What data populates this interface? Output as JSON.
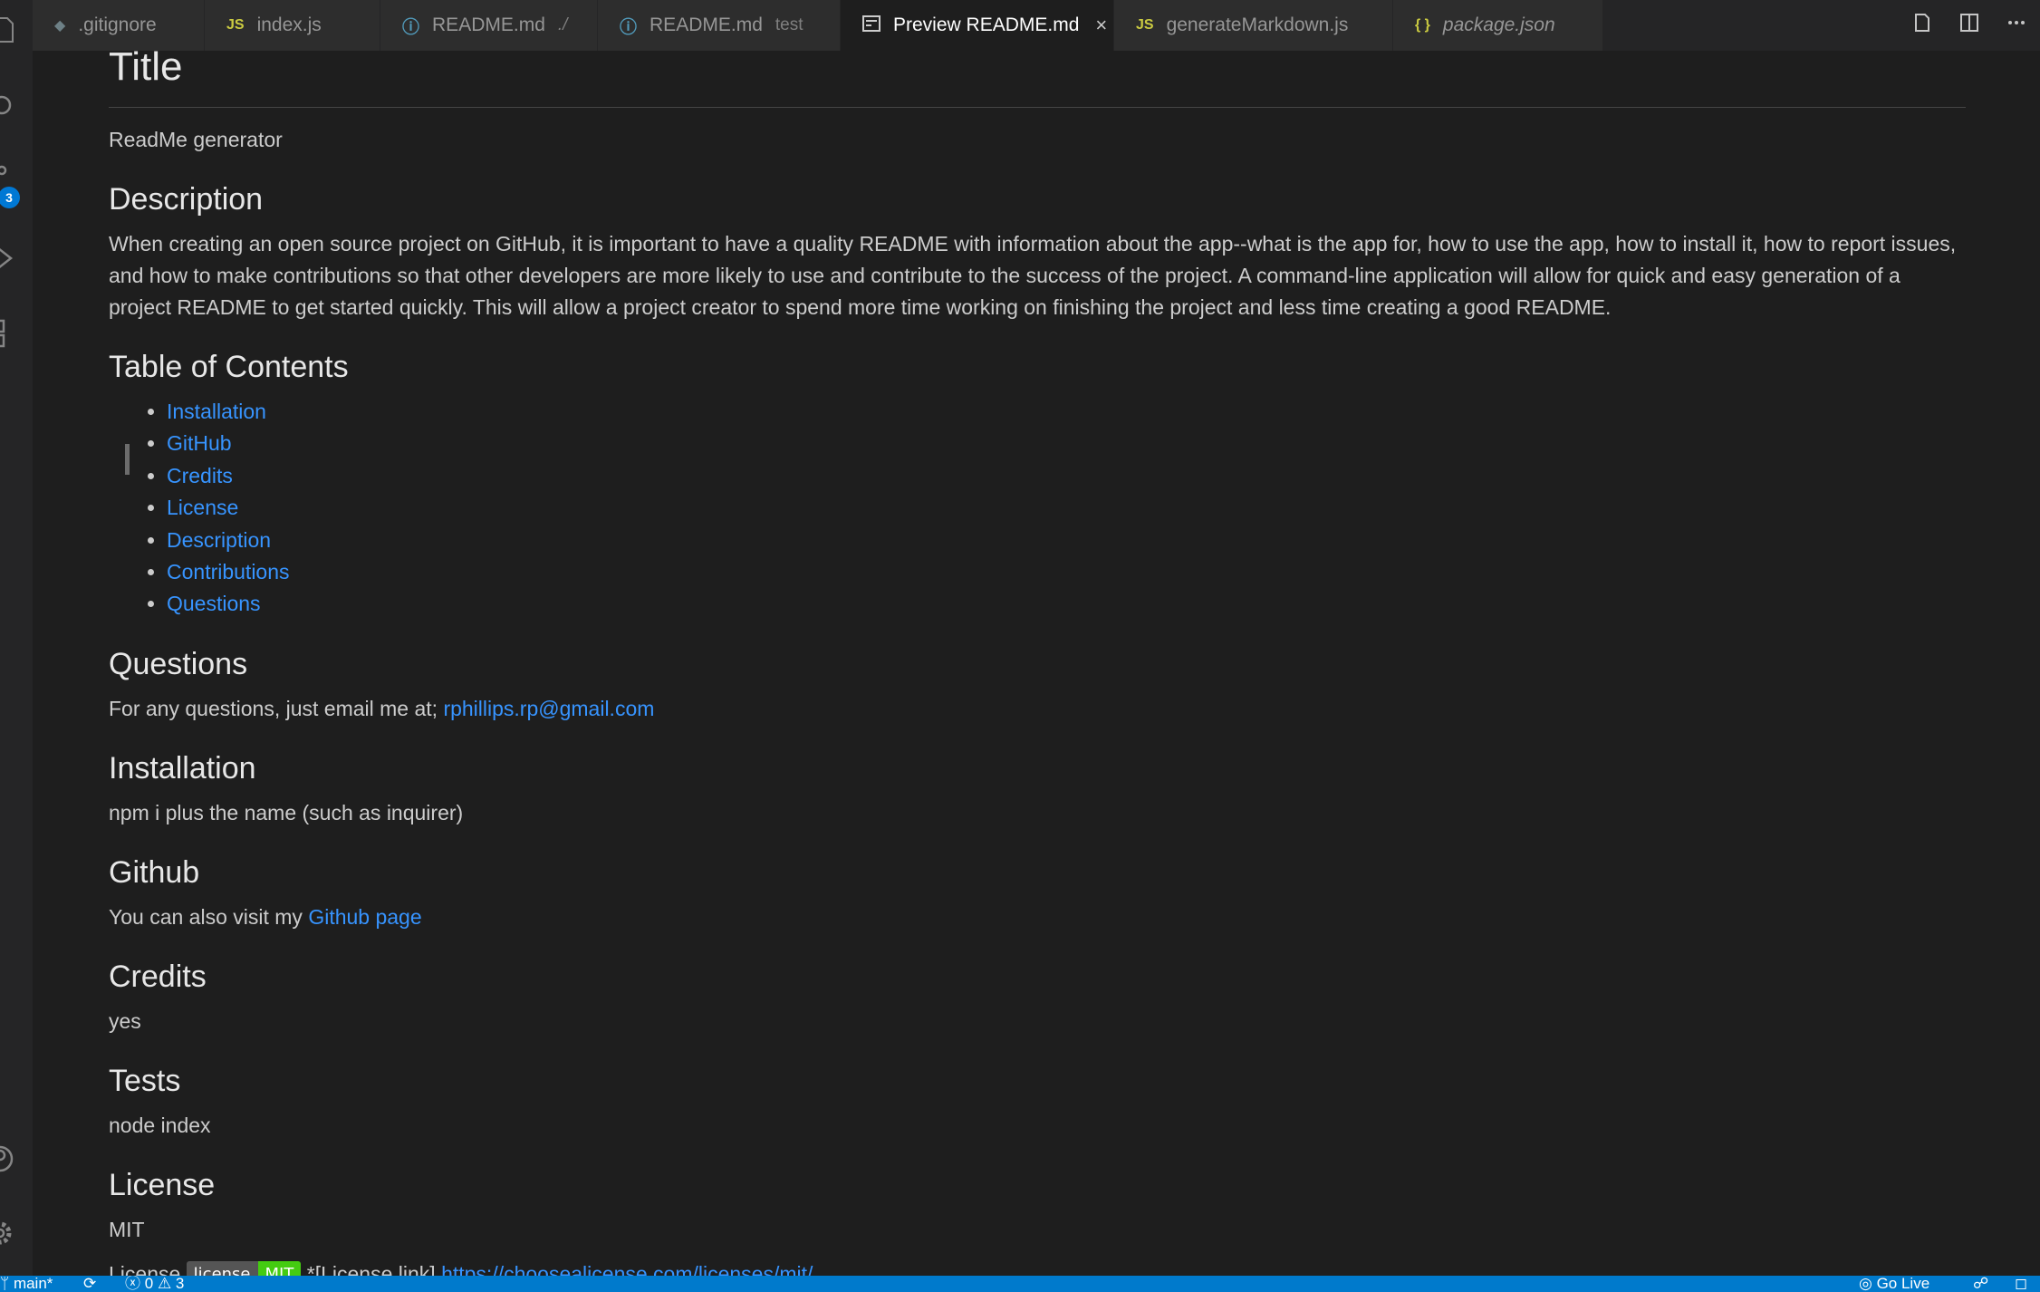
{
  "activity_bar": {
    "icons": [
      "explorer-icon",
      "search-icon",
      "source-control-icon",
      "run-debug-icon",
      "extensions-icon",
      "accounts-icon",
      "settings-gear-icon"
    ],
    "source_control_badge": "3"
  },
  "tabs": [
    {
      "label": ".gitignore",
      "icon": "git-icon",
      "desc": ""
    },
    {
      "label": "index.js",
      "icon": "js-icon",
      "desc": ""
    },
    {
      "label": "README.md",
      "icon": "info-icon",
      "desc": "./"
    },
    {
      "label": "README.md",
      "icon": "info-icon",
      "desc": "test"
    },
    {
      "label": "Preview README.md",
      "icon": "preview-icon",
      "desc": "",
      "active": true
    },
    {
      "label": "generateMarkdown.js",
      "icon": "js-icon",
      "desc": ""
    },
    {
      "label": "package.json",
      "icon": "json-icon",
      "desc": ""
    }
  ],
  "tab_glyphs": {
    "js": "JS",
    "json": "{ }",
    "git": "◆",
    "info": "ⓘ",
    "close": "×"
  },
  "editor_actions": [
    "open-source-icon",
    "split-editor-icon",
    "more-actions-icon"
  ],
  "readme": {
    "title": "Title",
    "title_text": "ReadMe generator",
    "description_heading": "Description",
    "description_text": "When creating an open source project on GitHub, it is important to have a quality README with information about the app--what is the app for, how to use the app, how to install it, how to report issues, and how to make contributions so that other developers are more likely to use and contribute to the success of the project. A command-line application will allow for quick and easy generation of a project README to get started quickly. This will allow a project creator to spend more time working on finishing the project and less time creating a good README.",
    "toc_heading": "Table of Contents",
    "toc": [
      "Installation",
      "GitHub",
      "Credits",
      "License",
      "Description",
      "Contributions",
      "Questions"
    ],
    "questions_heading": "Questions",
    "questions_text": "For any questions, just email me at; ",
    "questions_email": "rphillips.rp@gmail.com",
    "installation_heading": "Installation",
    "installation_text": "npm i plus the name (such as inquirer)",
    "github_heading": "Github",
    "github_text": "You can also visit my ",
    "github_link": "Github page",
    "credits_heading": "Credits",
    "credits_text": "yes",
    "tests_heading": "Tests",
    "tests_text": "node index",
    "license_heading": "License",
    "license_text": "MIT",
    "license_line_prefix": "License",
    "badge_left": "license",
    "badge_right": "MIT",
    "license_link_text": "*[License link]",
    "license_url": "https://choosealicense.com/licenses/mit/"
  },
  "status_bar": {
    "branch": "main*",
    "errors": "0",
    "warnings": "3",
    "go_live": "Go Live"
  }
}
